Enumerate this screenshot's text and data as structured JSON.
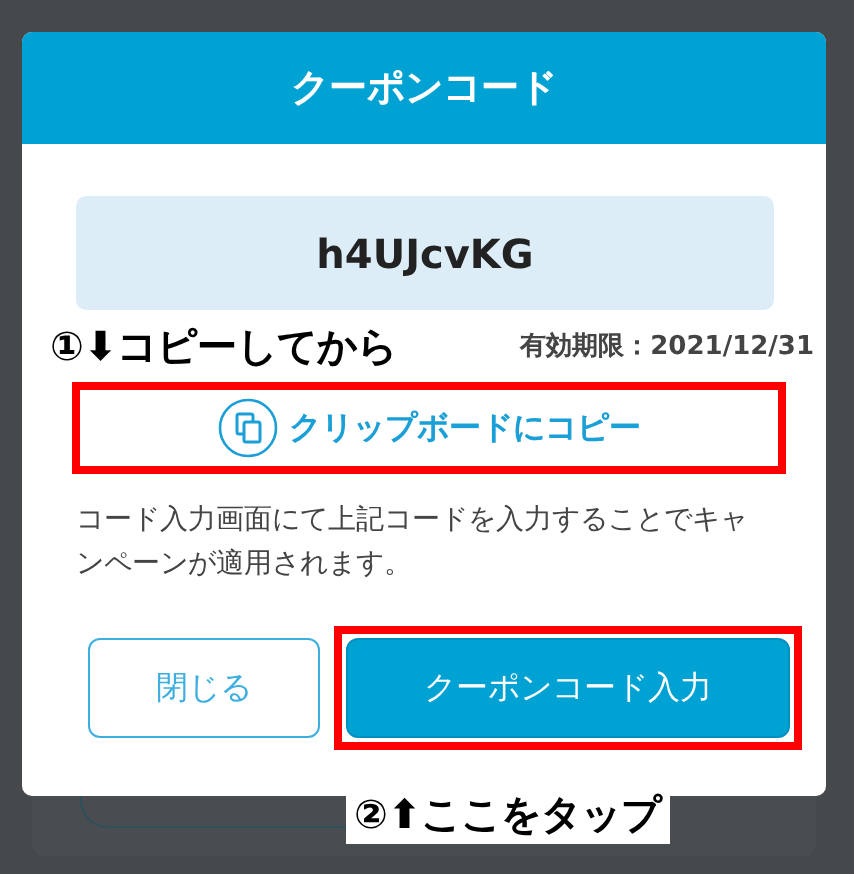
{
  "dialog": {
    "title": "クーポンコード",
    "code": "h4UJcvKG",
    "expiry": "有効期限：2021/12/31",
    "copy_link": {
      "label": "クリップボードにコピー",
      "highlighted": true
    },
    "message": "コード入力画面にて上記コードを入力することでキャンペーンが適用されます。",
    "buttons": [
      {
        "label": "閉じる",
        "kind": "secondary",
        "highlighted": false
      },
      {
        "label": "クーポンコード入力",
        "kind": "primary",
        "highlighted": true
      }
    ]
  },
  "annotations": [
    {
      "text": "①⬇コピーしてから"
    },
    {
      "text": "②⬆ここをタップ"
    }
  ]
}
